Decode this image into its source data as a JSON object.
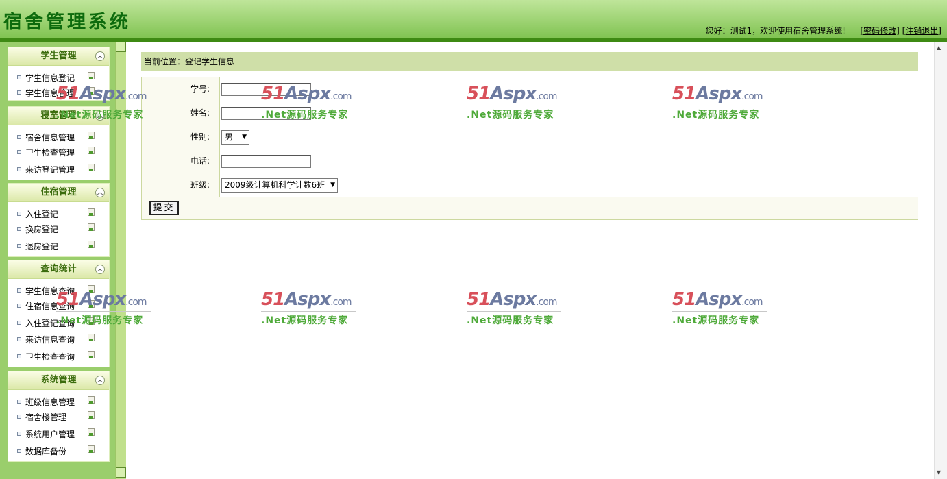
{
  "header": {
    "title": "宿舍管理系统",
    "welcome": "您好：测试1，欢迎使用宿舍管理系统!",
    "links": {
      "change_password": "[密码修改]",
      "logout": "[注销退出]"
    }
  },
  "sidebar": {
    "groups": [
      {
        "title": "学生管理",
        "items": [
          {
            "label": "学生信息登记"
          },
          {
            "label": "学生信息管理"
          }
        ]
      },
      {
        "title": "寝室管理",
        "items": [
          {
            "label": "宿舍信息管理"
          },
          {
            "label": "卫生检查管理"
          },
          {
            "label": "来访登记管理"
          }
        ]
      },
      {
        "title": "住宿管理",
        "items": [
          {
            "label": "入住登记"
          },
          {
            "label": "换房登记"
          },
          {
            "label": "退房登记"
          }
        ]
      },
      {
        "title": "查询统计",
        "items": [
          {
            "label": "学生信息查询"
          },
          {
            "label": "住宿信息查询"
          },
          {
            "label": "入住登记查询"
          },
          {
            "label": "来访信息查询"
          },
          {
            "label": "卫生检查查询"
          }
        ]
      },
      {
        "title": "系统管理",
        "items": [
          {
            "label": "班级信息管理"
          },
          {
            "label": "宿舍楼管理"
          },
          {
            "label": "系统用户管理"
          },
          {
            "label": "数据库备份"
          }
        ]
      }
    ]
  },
  "main": {
    "breadcrumb": "当前位置：登记学生信息",
    "form": {
      "student_id_label": "学号:",
      "student_id_value": "",
      "name_label": "姓名:",
      "name_value": "",
      "gender_label": "性别:",
      "gender_selected": "男",
      "phone_label": "电话:",
      "phone_value": "",
      "class_label": "班级:",
      "class_selected": "2009级计算机科学计数6班",
      "submit_label": "提交"
    }
  },
  "watermark": {
    "logo_num": "51",
    "logo_aspx": "Aspx",
    "logo_domain": ".com",
    "slogan": ".Net源码服务专家"
  }
}
